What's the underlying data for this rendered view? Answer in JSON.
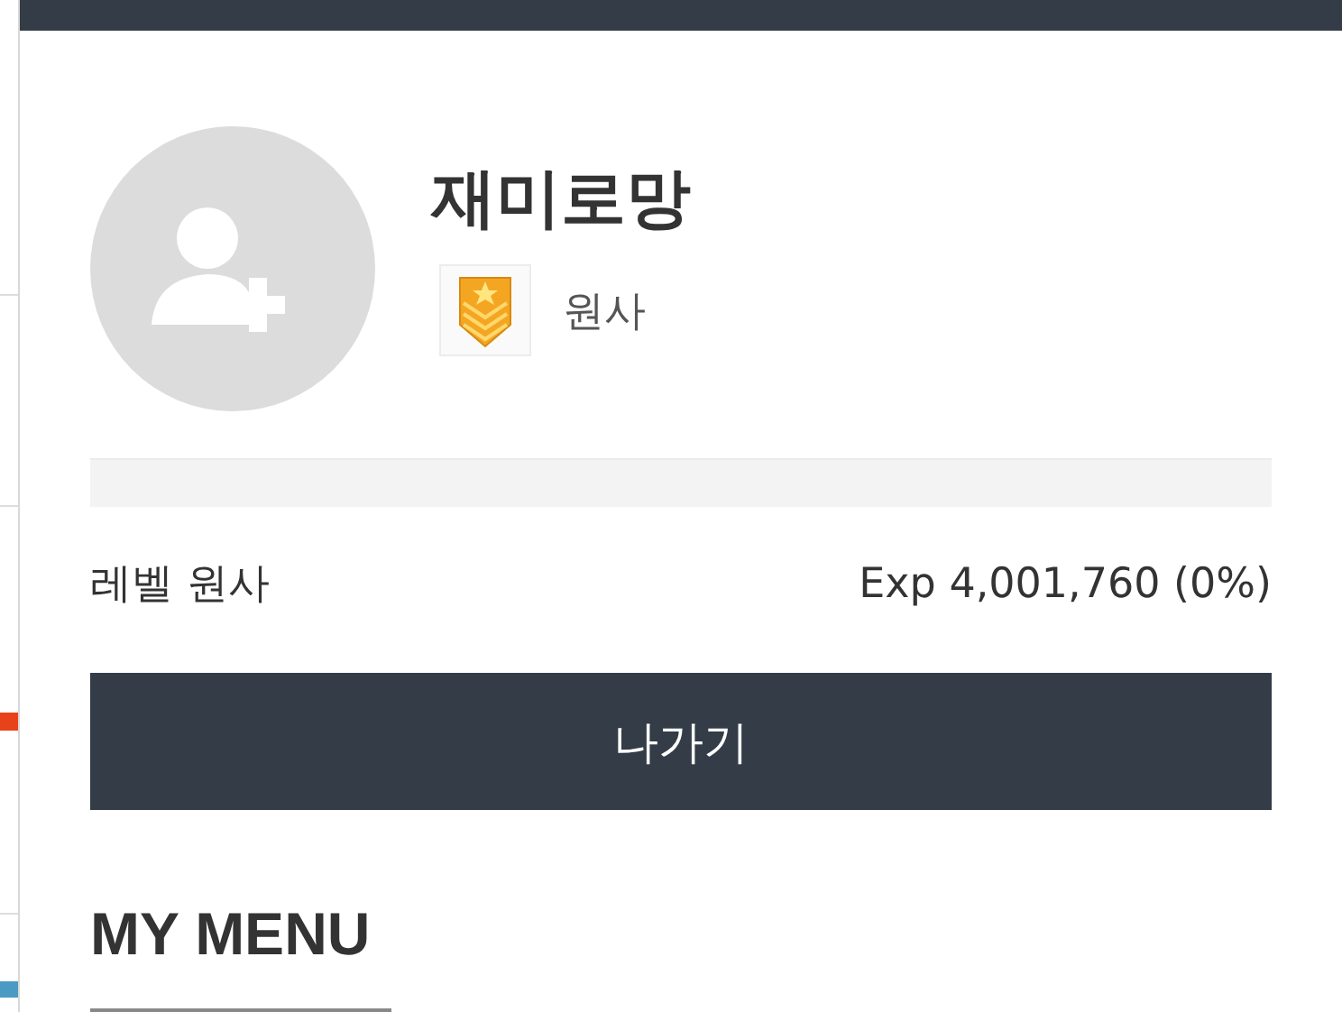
{
  "profile": {
    "name": "재미로망",
    "rank": "원사"
  },
  "experience": {
    "level": 0,
    "level_label": "레벨 원사",
    "reading": "Exp 4,001,760 (0%)"
  },
  "logout_button": "나가기",
  "menu_heading": "MY MENU"
}
